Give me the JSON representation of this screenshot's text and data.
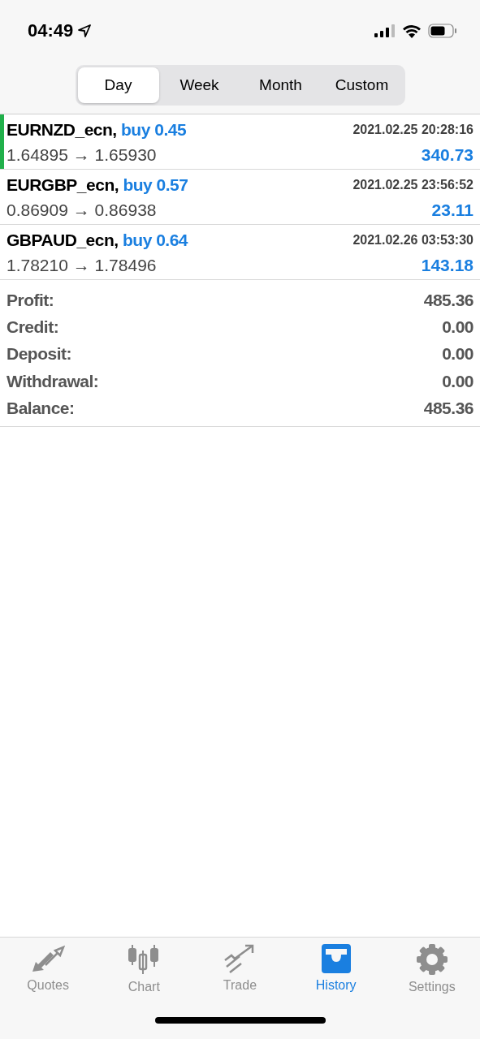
{
  "status_bar": {
    "time": "04:49"
  },
  "periods": [
    {
      "label": "Day",
      "selected": true
    },
    {
      "label": "Week",
      "selected": false
    },
    {
      "label": "Month",
      "selected": false
    },
    {
      "label": "Custom",
      "selected": false
    }
  ],
  "deals": [
    {
      "symbol": "EURNZD_ecn,",
      "action": "buy 0.45",
      "time": "2021.02.25 20:28:16",
      "prices": "1.64895 → 1.65930",
      "profit": "340.73",
      "selected": true
    },
    {
      "symbol": "EURGBP_ecn,",
      "action": "buy 0.57",
      "time": "2021.02.25 23:56:52",
      "prices": "0.86909 → 0.86938",
      "profit": "23.11",
      "selected": false
    },
    {
      "symbol": "GBPAUD_ecn,",
      "action": "buy 0.64",
      "time": "2021.02.26 03:53:30",
      "prices": "1.78210 → 1.78496",
      "profit": "143.18",
      "selected": false
    }
  ],
  "summary": [
    {
      "label": "Profit:",
      "value": "485.36"
    },
    {
      "label": "Credit:",
      "value": "0.00"
    },
    {
      "label": "Deposit:",
      "value": "0.00"
    },
    {
      "label": "Withdrawal:",
      "value": "0.00"
    },
    {
      "label": "Balance:",
      "value": "485.36"
    }
  ],
  "tab_bar": [
    {
      "label": "Quotes",
      "kind": "quotes",
      "selected": false
    },
    {
      "label": "Chart",
      "kind": "chart",
      "selected": false
    },
    {
      "label": "Trade",
      "kind": "trade",
      "selected": false
    },
    {
      "label": "History",
      "kind": "history",
      "selected": true
    },
    {
      "label": "Settings",
      "kind": "settings",
      "selected": false
    }
  ]
}
